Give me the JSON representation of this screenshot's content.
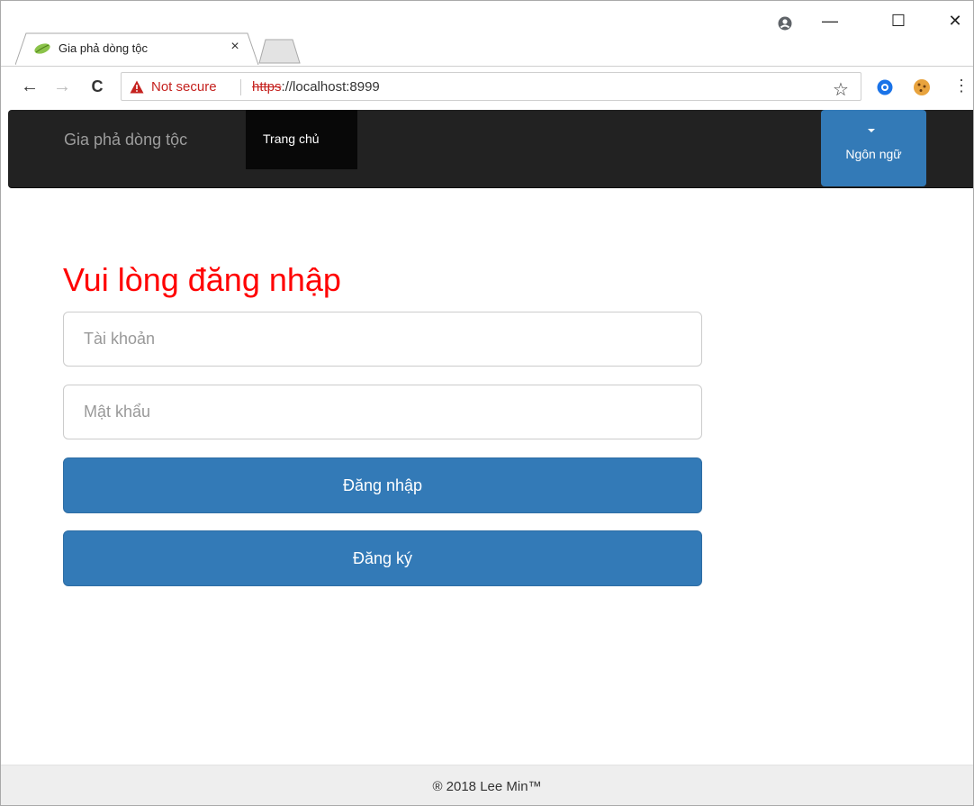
{
  "browser": {
    "tab": {
      "title": "Gia phả dòng tộc",
      "close": "×"
    },
    "controls": {
      "minimize": "—",
      "maximize": "☐",
      "close": "✕"
    },
    "nav": {
      "back": "←",
      "forward": "→",
      "reload": "C"
    },
    "address": {
      "security_label": "Not secure",
      "scheme": "https",
      "rest": "://localhost:8999"
    },
    "star": "☆",
    "menu": "⋮"
  },
  "navbar": {
    "brand": "Gia phả dòng tộc",
    "home": "Trang chủ",
    "language": "Ngôn ngữ"
  },
  "login": {
    "title": "Vui lòng đăng nhập",
    "username_placeholder": "Tài khoản",
    "password_placeholder": "Mật khẩu",
    "login_button": "Đăng nhập",
    "register_button": "Đăng ký"
  },
  "footer": {
    "text": "® 2018 Lee Min™"
  },
  "colors": {
    "navbar_bg": "#222222",
    "primary": "#337ab7",
    "title_red": "#ff0000",
    "footer_bg": "#eeeeee"
  }
}
